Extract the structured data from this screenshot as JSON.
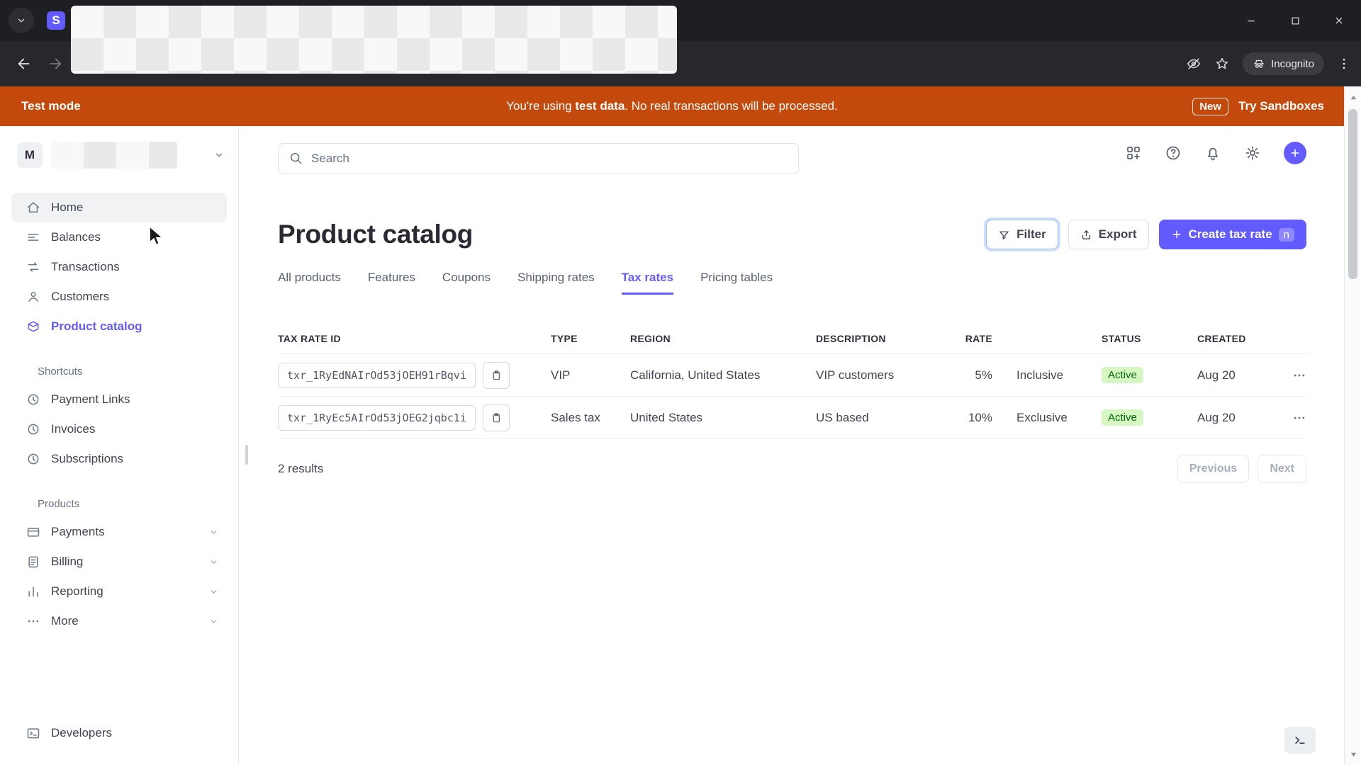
{
  "colors": {
    "accent": "#635BFF",
    "banner": "#C4490C",
    "badge_bg": "#D7F7C2",
    "badge_text": "#05690D"
  },
  "browser": {
    "favicon_letter": "S",
    "incognito_label": "Incognito"
  },
  "banner": {
    "mode_label": "Test mode",
    "message_prefix": "You're using ",
    "message_bold": "test data",
    "message_suffix": ". No real transactions will be processed.",
    "new_badge": "New",
    "cta": "Try Sandboxes"
  },
  "sidebar": {
    "account_initial": "M",
    "nav": [
      {
        "label": "Home"
      },
      {
        "label": "Balances"
      },
      {
        "label": "Transactions"
      },
      {
        "label": "Customers"
      },
      {
        "label": "Product catalog"
      }
    ],
    "shortcuts_heading": "Shortcuts",
    "shortcuts": [
      {
        "label": "Payment Links"
      },
      {
        "label": "Invoices"
      },
      {
        "label": "Subscriptions"
      }
    ],
    "products_heading": "Products",
    "products": [
      {
        "label": "Payments"
      },
      {
        "label": "Billing"
      },
      {
        "label": "Reporting"
      },
      {
        "label": "More"
      }
    ],
    "developers_label": "Developers"
  },
  "topbar": {
    "search_placeholder": "Search"
  },
  "page": {
    "title": "Product catalog",
    "actions": {
      "filter": "Filter",
      "export": "Export",
      "create": "Create tax rate",
      "create_shortcut": "n"
    },
    "tabs": [
      {
        "label": "All products"
      },
      {
        "label": "Features"
      },
      {
        "label": "Coupons"
      },
      {
        "label": "Shipping rates"
      },
      {
        "label": "Tax rates"
      },
      {
        "label": "Pricing tables"
      }
    ],
    "active_tab": "Tax rates"
  },
  "table": {
    "columns": [
      "TAX RATE ID",
      "TYPE",
      "REGION",
      "DESCRIPTION",
      "RATE",
      "STATUS",
      "CREATED"
    ],
    "rows": [
      {
        "id": "txr_1RyEdNAIrOd53jOEH91rBqvi",
        "type": "VIP",
        "region": "California, United States",
        "description": "VIP customers",
        "rate": "5%",
        "rate_kind": "Inclusive",
        "status": "Active",
        "created": "Aug 20"
      },
      {
        "id": "txr_1RyEc5AIrOd53jOEG2jqbc1i",
        "type": "Sales tax",
        "region": "United States",
        "description": "US based",
        "rate": "10%",
        "rate_kind": "Exclusive",
        "status": "Active",
        "created": "Aug 20"
      }
    ],
    "results_text": "2 results",
    "pagination": {
      "previous": "Previous",
      "next": "Next"
    }
  }
}
